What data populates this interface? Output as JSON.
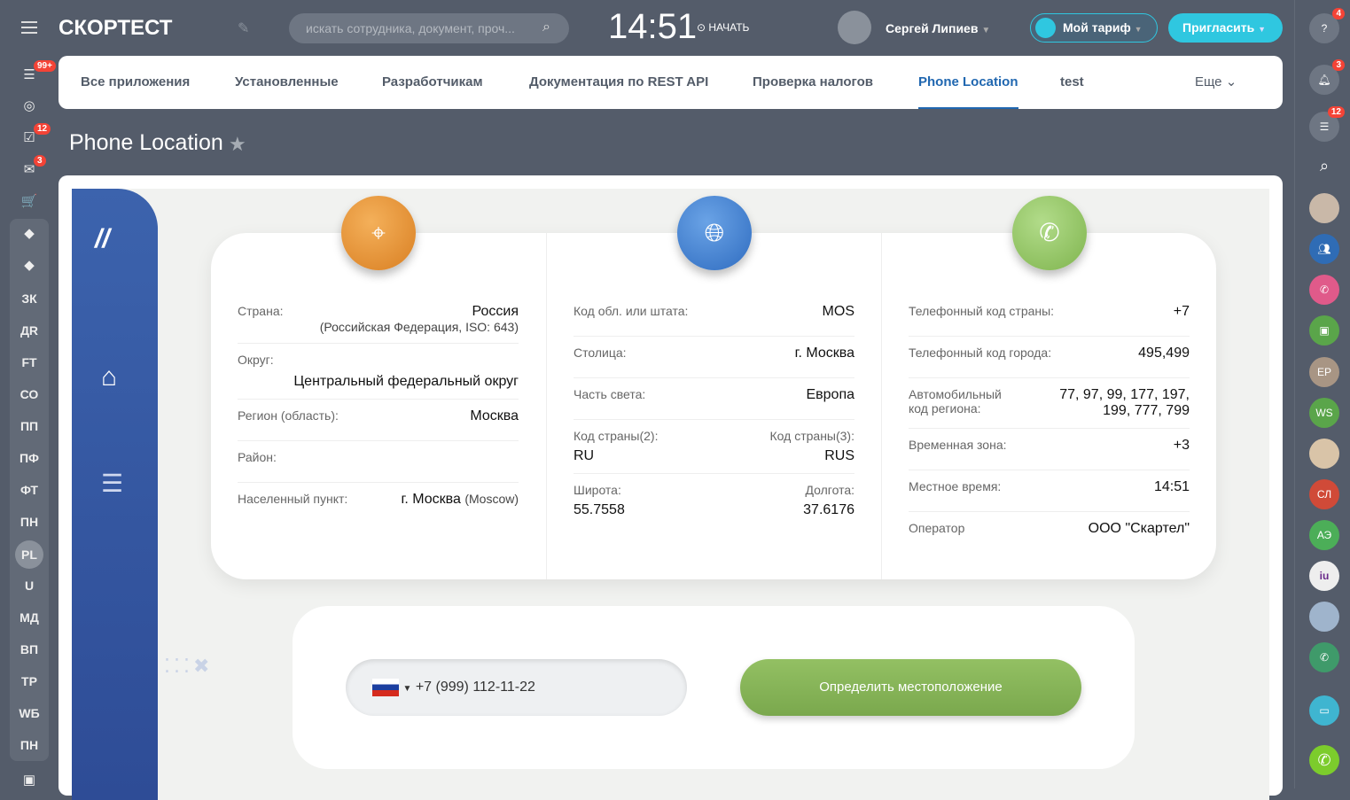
{
  "header": {
    "logo": "СКОРТЕСТ",
    "search_placeholder": "искать сотрудника, документ, проч...",
    "clock": "14:51",
    "start": "НАЧАТЬ",
    "user": "Сергей Липиев",
    "tarif": "Мой тариф",
    "invite": "Пригласить"
  },
  "left_sidebar": {
    "badges": {
      "feed": "99+",
      "tasks": "12",
      "mail": "3"
    },
    "apps": [
      "ЗК",
      "ДR",
      "FT",
      "СО",
      "ПП",
      "ПФ",
      "ФТ",
      "ПН",
      "PL",
      "U",
      "МД",
      "ВП",
      "ТР",
      "WБ",
      "ПН"
    ]
  },
  "tabs": [
    {
      "label": "Все приложения"
    },
    {
      "label": "Установленные"
    },
    {
      "label": "Разработчикам"
    },
    {
      "label": "Документация по REST API"
    },
    {
      "label": "Проверка налогов"
    },
    {
      "label": "Phone Location"
    },
    {
      "label": "test"
    },
    {
      "label": "Еще"
    }
  ],
  "page": {
    "title": "Phone Location"
  },
  "col1": [
    {
      "label": "Страна:",
      "value": "Россия",
      "sub": "(Российская Федерация, ISO: 643)"
    },
    {
      "label": "Округ:",
      "value": "Центральный федеральный округ"
    },
    {
      "label": "Регион (область):",
      "value": "Москва"
    },
    {
      "label": "Район:",
      "value": ""
    },
    {
      "label": "Населенный пункт:",
      "value": "г. Москва",
      "sub": "(Moscow)"
    }
  ],
  "col2": [
    {
      "label": "Код обл. или штата:",
      "value": "MOS"
    },
    {
      "label": "Столица:",
      "value": "г. Москва"
    },
    {
      "label": "Часть света:",
      "value": "Европа"
    },
    {
      "label": "Код страны(2):",
      "value": "RU",
      "label2": "Код страны(3):",
      "value2": "RUS"
    },
    {
      "label": "Широта:",
      "value": "55.7558",
      "label2": "Долгота:",
      "value2": "37.6176"
    }
  ],
  "col3": [
    {
      "label": "Телефонный код страны:",
      "value": "+7"
    },
    {
      "label": "Телефонный код города:",
      "value": "495,499"
    },
    {
      "label": "Автомобильный код региона:",
      "value": "77, 97, 99, 177, 197, 199, 777, 799"
    },
    {
      "label": "Временная зона:",
      "value": "+3"
    },
    {
      "label": "Местное время:",
      "value": "14:51"
    },
    {
      "label": "Оператор",
      "value": "ООО \"Скартел\""
    }
  ],
  "form": {
    "country_code": "+7",
    "phone": "(999) 112-11-22",
    "button": "Определить местоположение"
  },
  "right_sidebar": {
    "badges": {
      "help": "4",
      "notifications": "3",
      "chats": "12"
    },
    "contacts": [
      "EP",
      "WS",
      "СЛ",
      "АЭ"
    ]
  },
  "colors": {
    "accent": "#2067b0",
    "invite": "#2fc7e0",
    "green": "#8bb55a",
    "orange": "#e8962f",
    "blue": "#3f7fd0"
  }
}
